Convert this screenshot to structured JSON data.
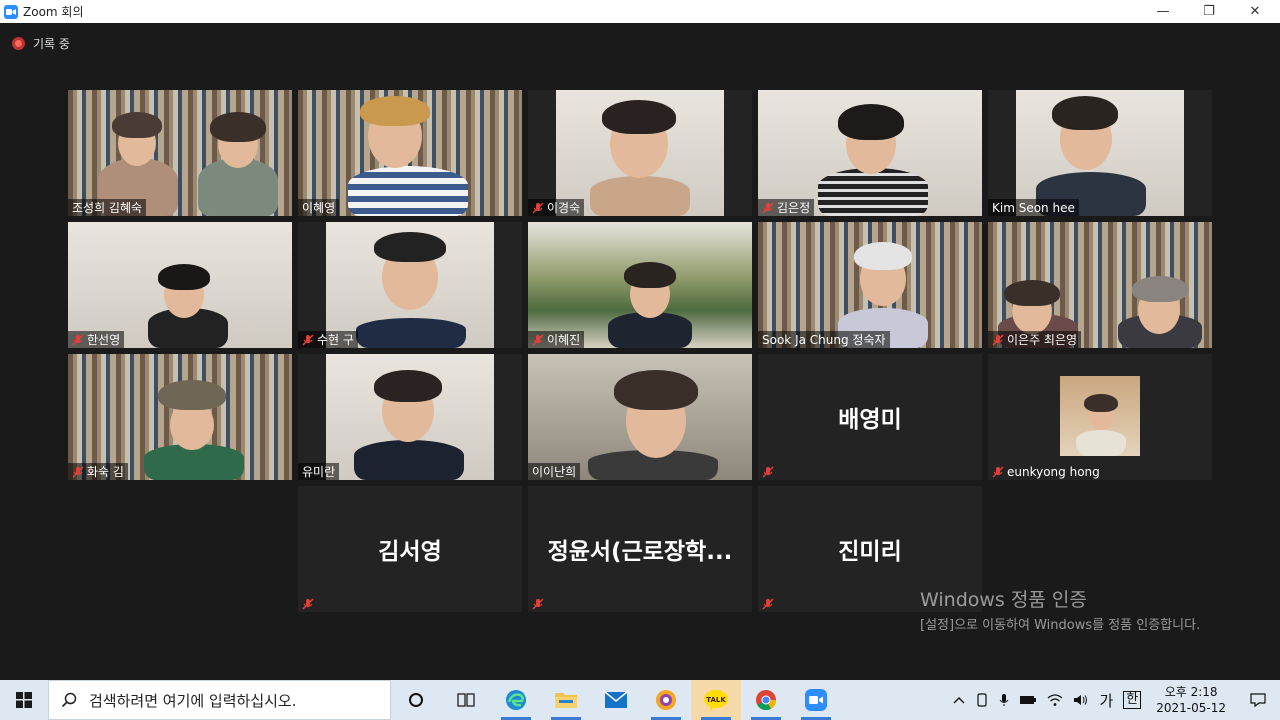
{
  "window": {
    "title": "Zoom 회의",
    "minimize": "—",
    "restore": "❐",
    "close": "✕"
  },
  "recording": {
    "label": "기록 중"
  },
  "tiles": [
    {
      "name": "조성희 김혜숙",
      "muted": false
    },
    {
      "name": "이혜영",
      "muted": false,
      "active": true
    },
    {
      "name": "이경숙",
      "muted": true
    },
    {
      "name": "김은정",
      "muted": true
    },
    {
      "name": "Kim Seon hee",
      "muted": false
    },
    {
      "name": "한선영",
      "muted": true
    },
    {
      "name": "수현 구",
      "muted": true
    },
    {
      "name": "이혜진",
      "muted": true
    },
    {
      "name": "Sook Ja Chung 정숙자",
      "muted": false
    },
    {
      "name": "이은주 최은영",
      "muted": true
    },
    {
      "name": "화숙 김",
      "muted": true
    },
    {
      "name": "유미란",
      "muted": false
    },
    {
      "name": "이이난희",
      "muted": false
    },
    {
      "name": "배영미",
      "muted": true,
      "video": false
    },
    {
      "name": "eunkyong hong",
      "muted": true,
      "video": false,
      "avatar": true
    },
    {
      "name": "김서영",
      "muted": true,
      "video": false
    },
    {
      "name": "정윤서(근로장학...",
      "muted": true,
      "video": false
    },
    {
      "name": "진미리",
      "muted": true,
      "video": false
    }
  ],
  "watermark": {
    "title": "Windows 정품 인증",
    "body": "[설정]으로 이동하여 Windows를 정품 인증합니다."
  },
  "taskbar": {
    "search_placeholder": "검색하려면 여기에 입력하십시오.",
    "apps": [
      "task-view",
      "edge",
      "file-explorer",
      "mail",
      "chrome-like",
      "kakaotalk",
      "chrome",
      "zoom"
    ],
    "ime_mode": "가",
    "ime_hanja": "한",
    "time": "오후 2:18",
    "date": "2021-05-12"
  },
  "colors": {
    "active_speaker": "#d7e34a",
    "muted_mic": "#e0403a",
    "zoom_blue": "#2d8cff",
    "background": "#1a1a1a"
  }
}
